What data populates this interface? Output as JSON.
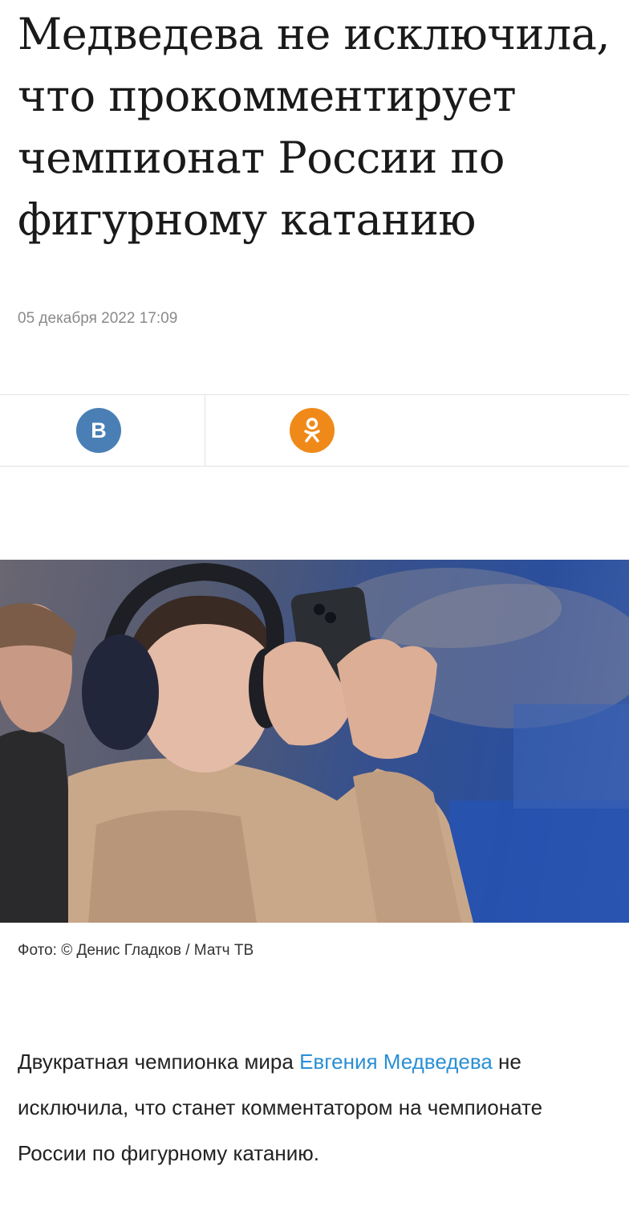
{
  "article": {
    "title": "Медведева не исключила, что прокомментирует чемпионат России по фигурному катанию",
    "date": "05 декабря 2022 17:09",
    "photo_caption": "Фото: © Денис Гладков / Матч ТВ",
    "body": {
      "before_link": "Двукратная чемпионка мира ",
      "link_text": "Евгения Медведева",
      "after_link": " не исключила, что станет комментатором на чемпионате России по фигурному катанию."
    }
  },
  "share": {
    "vk": {
      "icon": "vk-icon",
      "glyph": "В",
      "color": "#4a7fb6"
    },
    "ok": {
      "icon": "odnoklassniki-icon",
      "color": "#ef8a1a"
    }
  },
  "colors": {
    "link": "#2a8fd4",
    "date": "#8a8a8a"
  }
}
